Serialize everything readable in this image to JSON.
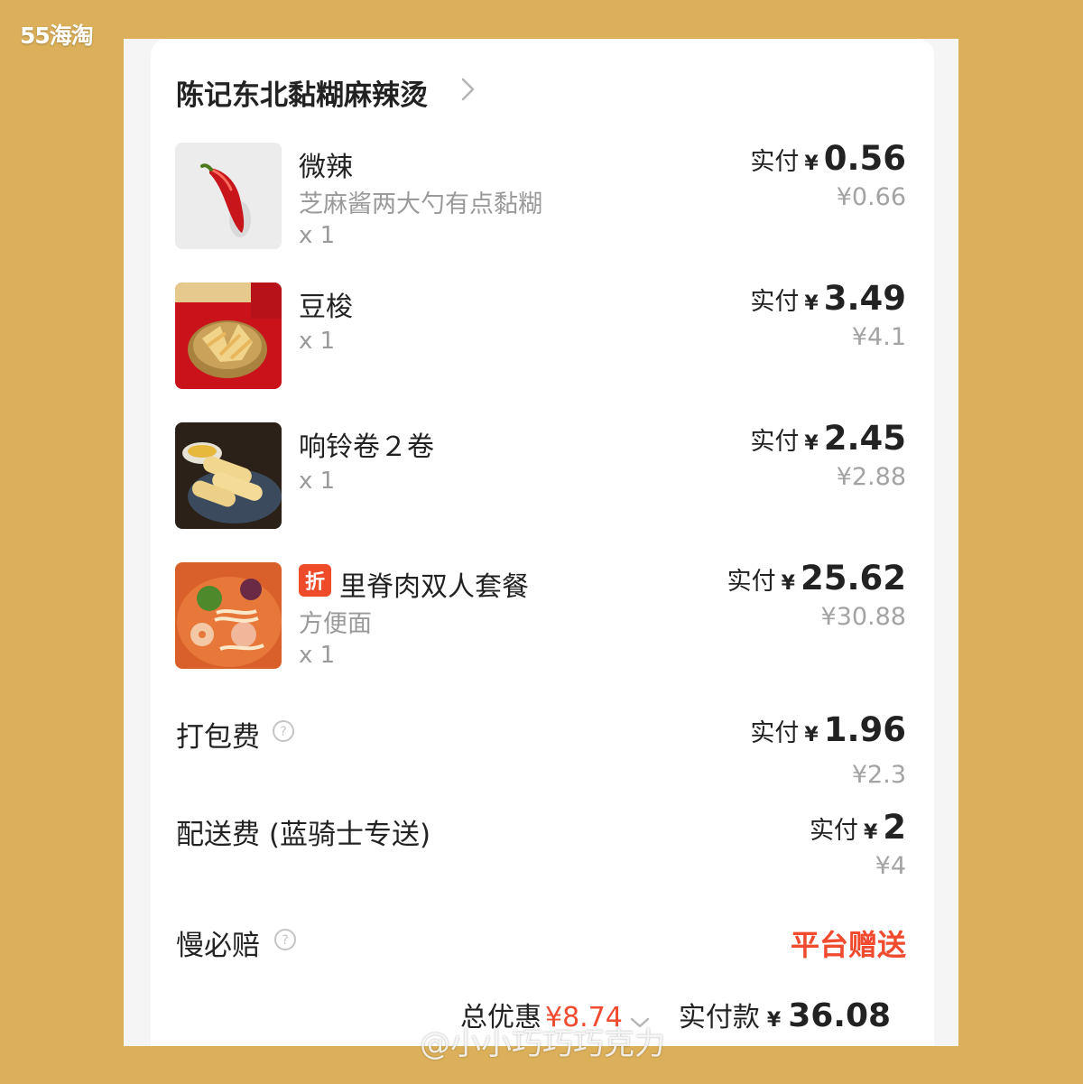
{
  "brand_watermark": "55海淘",
  "shop": {
    "name": "陈记东北黏糊麻辣烫"
  },
  "items": [
    {
      "name": "微辣",
      "spec": "芝麻酱两大勺有点黏糊",
      "qty": "x 1",
      "paid_prefix": "实付",
      "currency": "¥",
      "paid": "0.56",
      "original": "¥0.66",
      "image": "red-chili-pepper-photo"
    },
    {
      "name": "豆梭",
      "spec": "",
      "qty": "x 1",
      "paid_prefix": "实付",
      "currency": "¥",
      "paid": "3.49",
      "original": "¥4.1",
      "image": "fried-bean-curd-sticks-photo"
    },
    {
      "name": "响铃卷２卷",
      "spec": "",
      "qty": "x 1",
      "paid_prefix": "实付",
      "currency": "¥",
      "paid": "2.45",
      "original": "¥2.88",
      "image": "tofu-skin-rolls-photo"
    },
    {
      "name": "里脊肉双人套餐",
      "badge": "折",
      "spec": "方便面",
      "qty": "x 1",
      "paid_prefix": "实付",
      "currency": "¥",
      "paid": "25.62",
      "original": "¥30.88",
      "image": "malatang-bowl-photo"
    }
  ],
  "fees": {
    "packing": {
      "label": "打包费",
      "paid_prefix": "实付",
      "currency": "¥",
      "paid": "1.96",
      "original": "¥2.3"
    },
    "delivery": {
      "label": "配送费 (蓝骑士专送)",
      "paid_prefix": "实付",
      "currency": "¥",
      "paid": "2",
      "original": "¥4"
    },
    "late_comp": {
      "label": "慢必赔",
      "value": "平台赠送"
    }
  },
  "summary": {
    "discount_label": "总优惠",
    "discount_value": "¥8.74",
    "total_label": "实付款",
    "currency": "¥",
    "total_value": "36.08"
  },
  "overlay_watermark": "@小小巧巧巧克力",
  "colors": {
    "accent_red": "#f04a2f",
    "background": "#dcb05a"
  }
}
